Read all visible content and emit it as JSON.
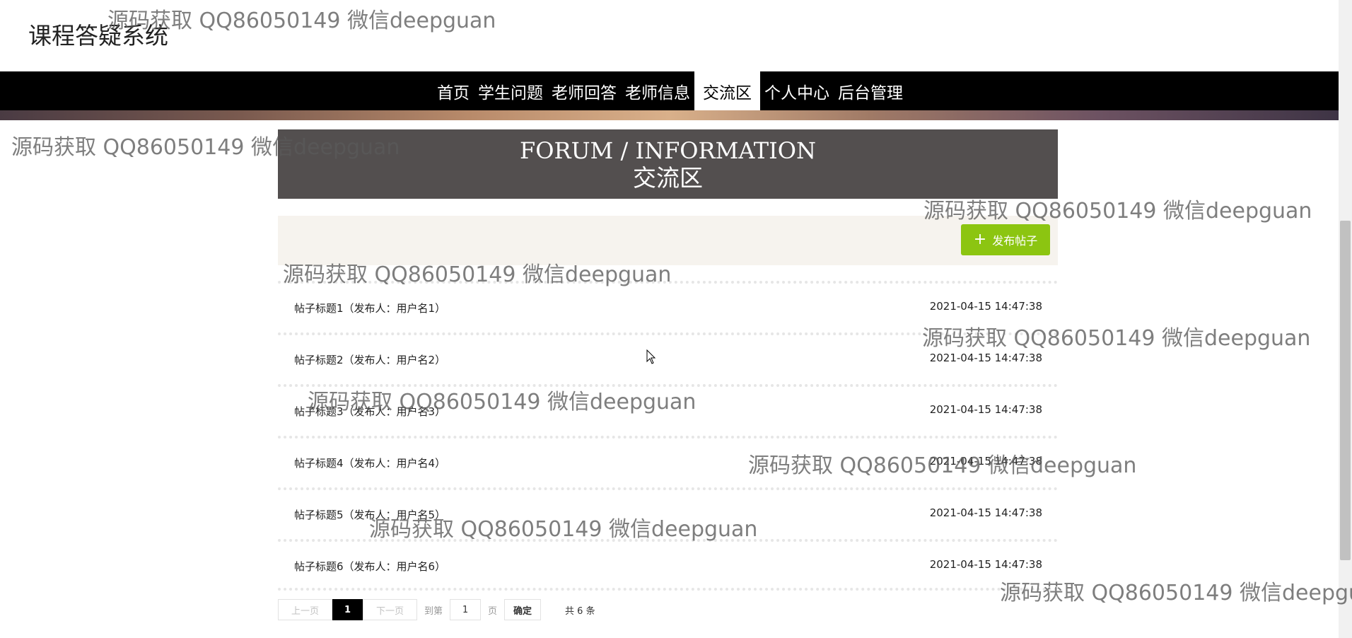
{
  "site": {
    "title": "课程答疑系统"
  },
  "nav": {
    "items": [
      {
        "label": "首页",
        "active": false
      },
      {
        "label": "学生问题",
        "active": false
      },
      {
        "label": "老师回答",
        "active": false
      },
      {
        "label": "老师信息",
        "active": false
      },
      {
        "label": "交流区",
        "active": true
      },
      {
        "label": "个人中心",
        "active": false
      },
      {
        "label": "后台管理",
        "active": false
      }
    ]
  },
  "forum": {
    "heading_en": "FORUM / INFORMATION",
    "heading_cn": "交流区",
    "post_button": "发布帖子",
    "posts": [
      {
        "title": "帖子标题1（发布人：用户名1）",
        "time": "2021-04-15 14:47:38"
      },
      {
        "title": "帖子标题2（发布人：用户名2）",
        "time": "2021-04-15 14:47:38"
      },
      {
        "title": "帖子标题3（发布人：用户名3）",
        "time": "2021-04-15 14:47:38"
      },
      {
        "title": "帖子标题4（发布人：用户名4）",
        "time": "2021-04-15 14:47:38"
      },
      {
        "title": "帖子标题5（发布人：用户名5）",
        "time": "2021-04-15 14:47:38"
      },
      {
        "title": "帖子标题6（发布人：用户名6）",
        "time": "2021-04-15 14:47:38"
      }
    ]
  },
  "pagination": {
    "prev": "上一页",
    "current": "1",
    "next": "下一页",
    "goto_label": "到第",
    "goto_value": "1",
    "page_unit": "页",
    "confirm": "确定",
    "total": "共 6 条"
  },
  "watermark": {
    "text": "源码获取 QQ86050149 微信deepguan"
  },
  "colors": {
    "nav_bg": "#000000",
    "header_bg": "#534f4f",
    "button_green": "#8cc511",
    "toolbar_bg": "#f6f3ee"
  }
}
